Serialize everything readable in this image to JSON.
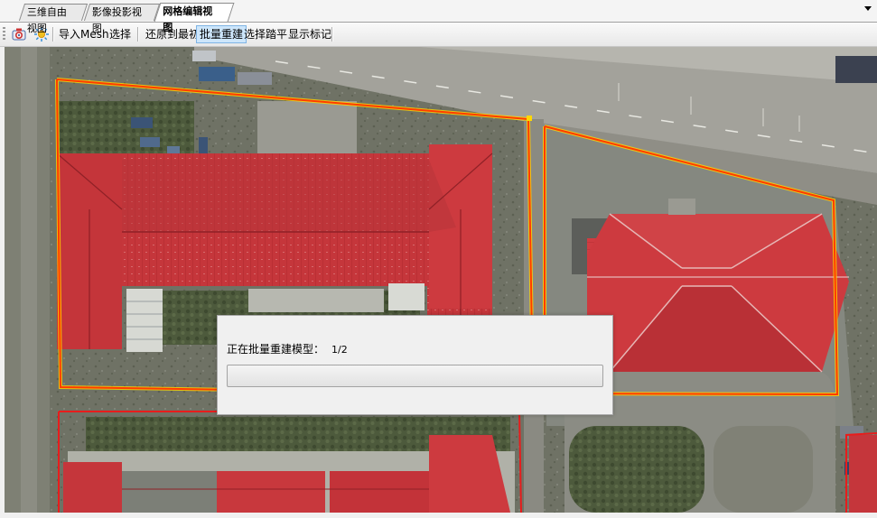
{
  "tabs": [
    {
      "label": "三维自由视图",
      "active": false
    },
    {
      "label": "影像投影视图",
      "active": false
    },
    {
      "label": "网格编辑视图",
      "active": true
    }
  ],
  "toolbar": {
    "icons": [
      "camera-icon",
      "sun-icon"
    ],
    "import_mesh": "导入Mesh",
    "select": "选择",
    "restore_initial": "还原到最初",
    "batch_rebuild": "批量重建",
    "select_flatten": "选择踏平",
    "show_marks": "显示标记",
    "active_button": "批量重建"
  },
  "dialog": {
    "message": "正在批量重建模型：",
    "count": "1/2",
    "progress_fraction": 0.0
  },
  "colors": {
    "roof_red": "#c8343a",
    "boundary_orange": "#ff3b00",
    "boundary_yellow": "#ffd800",
    "toolbar_active": "#cde6fb"
  }
}
